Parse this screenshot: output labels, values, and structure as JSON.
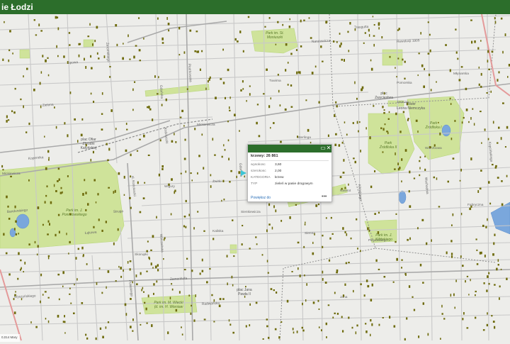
{
  "header": {
    "title": "ie Łodzi"
  },
  "map": {
    "streets": {
      "mickiewicza_upper": "Mickiewicza",
      "mickiewicza_left": "Mickiewicza",
      "zwirki": "Żwirki",
      "wigury": "Wigury",
      "kalinska": "Kaliska",
      "pulaskiego": "Pułaskiego",
      "kosciuszki": "al. Kościuszki",
      "piotrkowska": "Piotrkowska",
      "tuwima": "Tuwima",
      "wolczanska": "Wólczańska",
      "zamenhofa": "Zamenhofa",
      "nawrot": "Nawrot",
      "sienkiewicza": "Sienkiewicza",
      "kilinskiego": "Kilińskiego",
      "pilsudskiego": "Piłsudskiego",
      "radwanska": "Radwańska",
      "jaracza": "Jaracza",
      "pomorska": "Pomorska",
      "skorupki": "Skorupki",
      "wschodnia": "Wschodnia",
      "wierzbowa": "Wierzbowa",
      "fabryczna": "Fabryczna",
      "kopcinskiego": "Kopcińskiego",
      "lakowa": "Łąkowa",
      "bandurskiego": "Bandurskiego",
      "gdanska": "Gdańska",
      "struga": "Struga",
      "wyszynskiego": "Wyszyńskiego",
      "kopernika": "Kopernika",
      "zeromskiego": "Żeromskiego",
      "lipowa": "Lipowa",
      "gdanska2": "Gdańska",
      "mlynska": "Młynarska",
      "sterlinga": "Sterlinga",
      "narutowicza": "Narutowicza",
      "traugutta": "Traugutta",
      "rewolucji": "Rewolucji 1905",
      "kosciuszki2": "Kościuszki",
      "zielona": "Zielona",
      "jana": "Jana",
      "sienna": "Sienna"
    },
    "places": {
      "plac_ofiar": "plac Ofiar\nZbrodni\nKatyńskiej",
      "plac_zwyc": "plac\nZwycięstwa",
      "plac_dabrowskiego": "plac Dąbrowskiego",
      "plac_jana": "plac Jana\nPawła II",
      "plac_wolnosci": "plac Wolności",
      "skwer": "Skwer\nLeona Niemczyka"
    },
    "parks": {
      "park_moniuszki": "Park im. St.\nMoniuszki",
      "park_zrodliska1": "Park\nŹródliska I",
      "park_zrodliska2": "Park\nŹródliska II",
      "park_poniatowskiego": "Park im. J.\nPoniatowskiego",
      "park_kilinskiego": "Park im. J.\nKilińskiego",
      "park_wiecki": "Park im. M. Wiecki\n(d. im. H. Wieniaw"
    }
  },
  "popup": {
    "title": "krzewy: 26 861",
    "rows": [
      {
        "label": "wysokosc",
        "value": "3,60"
      },
      {
        "label": "szerokosc",
        "value": "2,00"
      },
      {
        "label": "KATEGORIA",
        "value": "krzew"
      },
      {
        "label": "TYP",
        "value": "zieleń w pasie drogowym"
      }
    ],
    "zoom_label": "Powiększ do",
    "more_label": "•••"
  },
  "scale": {
    "label": "0,014 Mary"
  }
}
